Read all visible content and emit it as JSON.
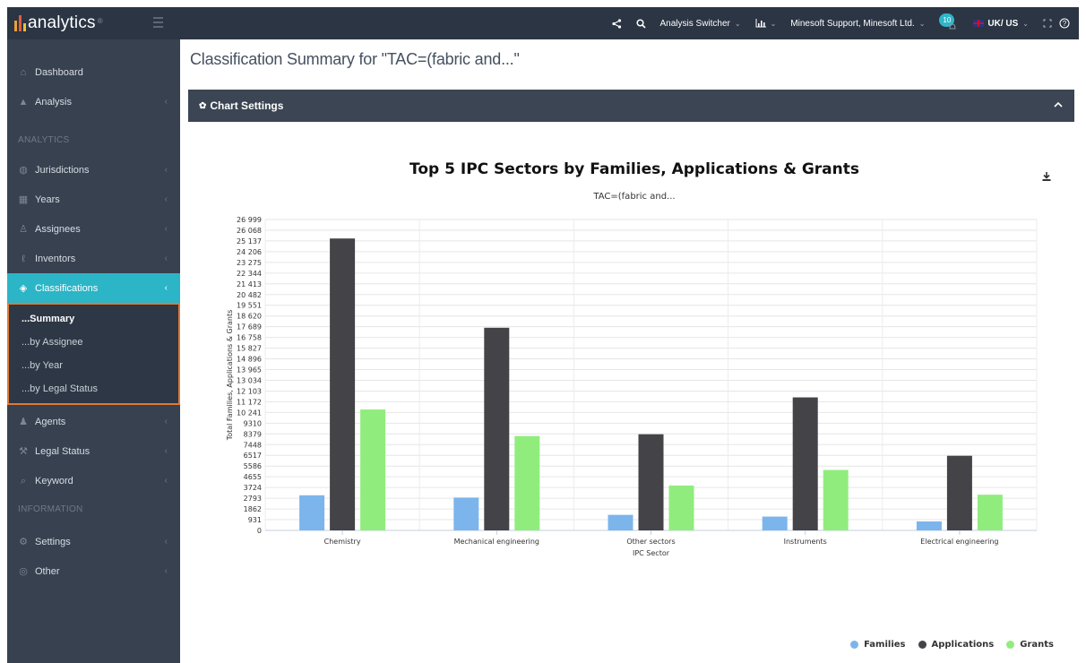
{
  "app": {
    "logo_text": "analytics",
    "logo_sup": "®"
  },
  "topbar": {
    "analysis_switcher": "Analysis Switcher",
    "account": "Minesoft Support, Minesoft Ltd.",
    "notifications": "10",
    "locale": "UK/ US"
  },
  "sidebar": {
    "items": [
      {
        "label": "Dashboard",
        "icon": "home-icon"
      },
      {
        "label": "Analysis",
        "icon": "area-chart-icon"
      },
      {
        "label": "Jurisdictions",
        "icon": "globe-icon"
      },
      {
        "label": "Years",
        "icon": "calendar-icon"
      },
      {
        "label": "Assignees",
        "icon": "user-icon"
      },
      {
        "label": "Inventors",
        "icon": "lightbulb-icon"
      },
      {
        "label": "Classifications",
        "icon": "layers-icon"
      },
      {
        "label": "Agents",
        "icon": "users-icon"
      },
      {
        "label": "Legal Status",
        "icon": "gavel-icon"
      },
      {
        "label": "Keyword",
        "icon": "search-icon"
      },
      {
        "label": "Settings",
        "icon": "gear-icon"
      },
      {
        "label": "Other",
        "icon": "dribbble-icon"
      }
    ],
    "sections": [
      "ANALYTICS",
      "INFORMATION"
    ],
    "submenu": [
      "...Summary",
      "...by Assignee",
      "...by Year",
      "...by Legal Status"
    ]
  },
  "main": {
    "title": "Classification Summary for \"TAC=(fabric and...\"",
    "chart_settings": "Chart Settings"
  },
  "colors": {
    "families": "#7cb5ec",
    "applications": "#434348",
    "grants": "#90ed7d"
  },
  "chart_data": {
    "type": "bar",
    "title": "Top 5 IPC Sectors by Families, Applications & Grants",
    "subtitle": "TAC=(fabric and...",
    "xlabel": "IPC Sector",
    "ylabel": "Total Families, Applications & Grants",
    "categories": [
      "Chemistry",
      "Mechanical engineering",
      "Other sectors",
      "Instruments",
      "Electrical engineering"
    ],
    "yticks": [
      "0",
      "931",
      "1862",
      "2793",
      "3724",
      "4655",
      "5586",
      "6517",
      "7448",
      "8379",
      "9310",
      "10 241",
      "11 172",
      "12 103",
      "13 034",
      "13 965",
      "14 896",
      "15 827",
      "16 758",
      "17 689",
      "18 620",
      "19 551",
      "20 482",
      "21 413",
      "22 344",
      "23 275",
      "24 206",
      "25 137",
      "26 068",
      "26 999"
    ],
    "ylim": [
      0,
      26999
    ],
    "series": [
      {
        "name": "Families",
        "values": [
          3050,
          2850,
          1350,
          1200,
          780
        ]
      },
      {
        "name": "Applications",
        "values": [
          25350,
          17600,
          8350,
          11550,
          6480
        ]
      },
      {
        "name": "Grants",
        "values": [
          10500,
          8200,
          3900,
          5250,
          3100
        ]
      }
    ],
    "grid": true,
    "legend": "bottom-right"
  }
}
